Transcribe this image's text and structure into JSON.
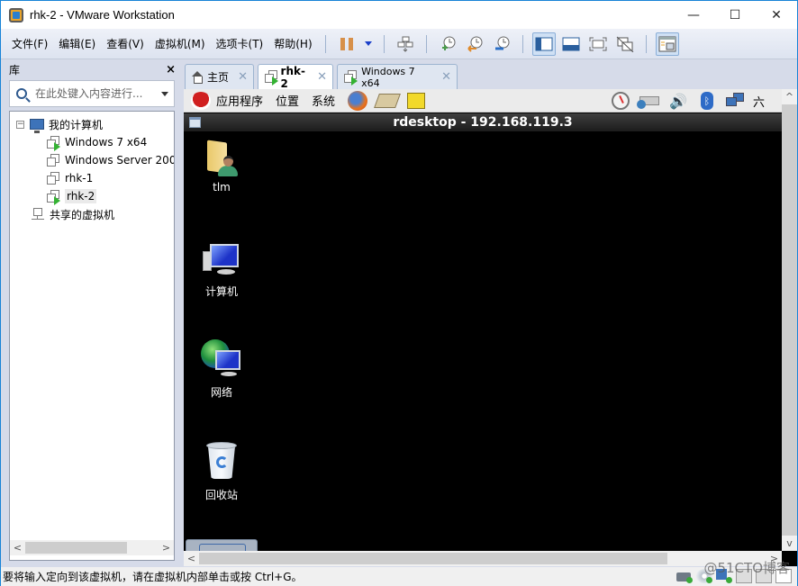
{
  "window": {
    "title": "rhk-2 - VMware Workstation",
    "controls": {
      "minimize": "—",
      "maximize": "☐",
      "close": "✕"
    }
  },
  "menubar": {
    "items": [
      {
        "label": "文件(F)"
      },
      {
        "label": "编辑(E)"
      },
      {
        "label": "查看(V)"
      },
      {
        "label": "虚拟机(M)"
      },
      {
        "label": "选项卡(T)"
      },
      {
        "label": "帮助(H)"
      }
    ]
  },
  "toolbar": {
    "buttons": [
      {
        "icon": "pause-icon"
      },
      {
        "icon": "dropdown-icon"
      },
      {
        "icon": "send-ctrl-alt-del-icon"
      },
      {
        "icon": "take-snapshot-icon"
      },
      {
        "icon": "revert-snapshot-icon"
      },
      {
        "icon": "snapshot-manager-icon"
      },
      {
        "icon": "show-library-icon",
        "active": true
      },
      {
        "icon": "thumbnail-bar-icon"
      },
      {
        "icon": "full-screen-icon"
      },
      {
        "icon": "unity-icon"
      },
      {
        "icon": "console-view-icon",
        "active": true
      }
    ]
  },
  "library": {
    "title": "库",
    "close": "×",
    "search": {
      "placeholder": "在此处键入内容进行...",
      "value": ""
    },
    "tree": {
      "root": {
        "label": "我的计算机",
        "toggle": "−"
      },
      "items": [
        {
          "label": "Windows 7 x64",
          "running": true
        },
        {
          "label": "Windows Server 200",
          "running": false
        },
        {
          "label": "rhk-1",
          "running": false
        },
        {
          "label": "rhk-2",
          "running": true,
          "selected": true
        }
      ],
      "shared": {
        "label": "共享的虚拟机"
      }
    },
    "scroll": {
      "left": "<",
      "right": ">"
    }
  },
  "tabs": [
    {
      "label": "主页",
      "icon": "home-icon",
      "active": false
    },
    {
      "label": "rhk-2",
      "icon": "vm-icon",
      "active": true
    },
    {
      "label": "Windows 7 x64",
      "icon": "vm-icon",
      "active": false
    }
  ],
  "tab_close": "✕",
  "guest": {
    "panel": {
      "menus": [
        {
          "label": "应用程序"
        },
        {
          "label": "位置"
        },
        {
          "label": "系统"
        }
      ],
      "clock_char": "六"
    },
    "rdesktop_title": "rdesktop - 192.168.119.3",
    "desktop_icons": [
      {
        "label": "tlm",
        "icon": "user-folder-icon"
      },
      {
        "label": "计算机",
        "icon": "computer-icon"
      },
      {
        "label": "网络",
        "icon": "network-icon"
      },
      {
        "label": "回收站",
        "icon": "recycle-bin-icon"
      }
    ],
    "scroll": {
      "up": "^",
      "down": "v",
      "left": "<",
      "right": ">"
    }
  },
  "statusbar": {
    "message": "要将输入定向到该虚拟机，请在虚拟机内部单击或按 Ctrl+G。",
    "watermark": "@51CTO博客"
  }
}
